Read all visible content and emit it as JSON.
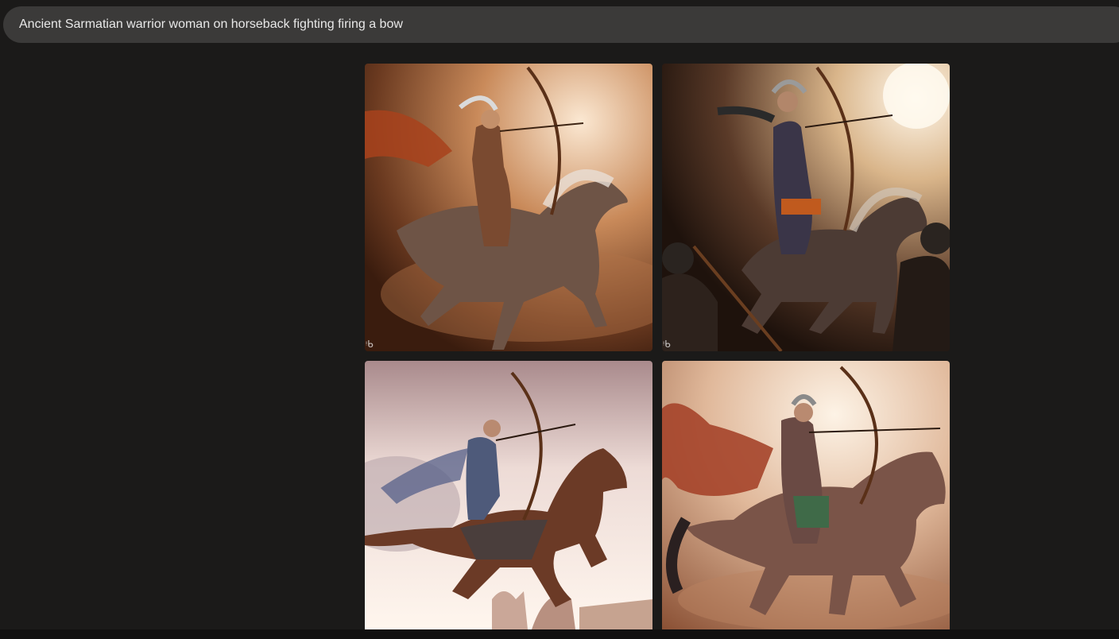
{
  "prompt": {
    "text": "Ancient Sarmatian warrior woman on horseback fighting firing a bow"
  },
  "images": [
    {
      "icon": "bing-watermark-icon"
    },
    {
      "icon": "bing-watermark-icon"
    },
    {
      "icon": null
    },
    {
      "icon": null
    }
  ]
}
